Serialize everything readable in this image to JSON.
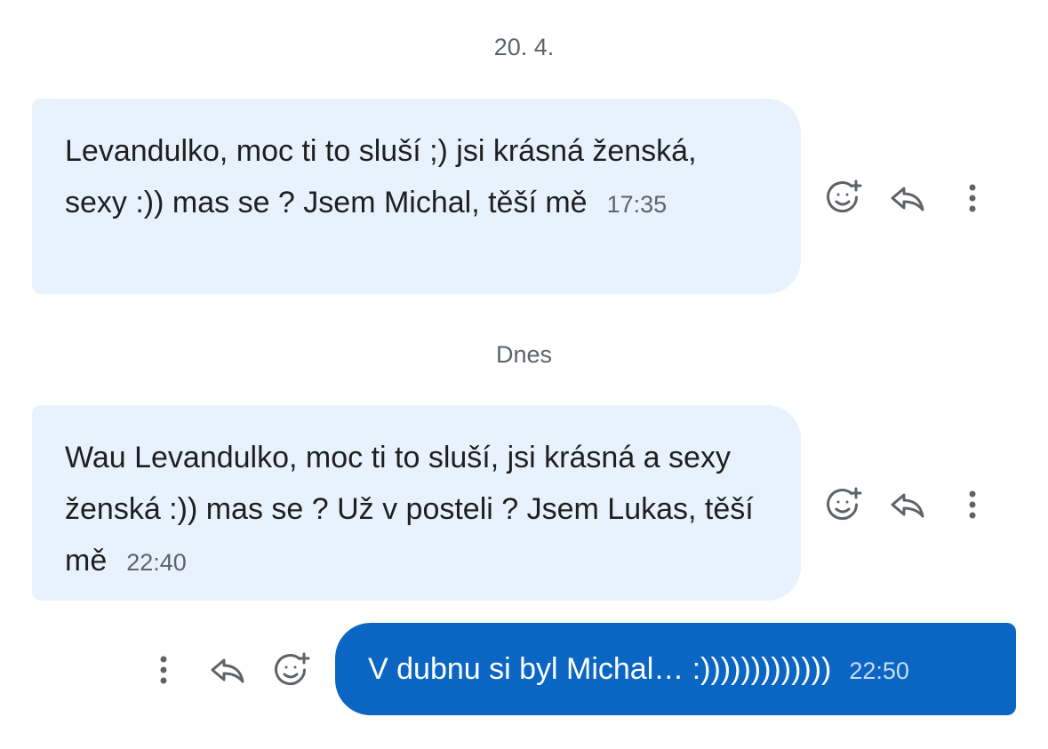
{
  "conversation": {
    "separators": [
      {
        "label": "20. 4."
      },
      {
        "label": "Dnes"
      }
    ],
    "messages": [
      {
        "direction": "incoming",
        "text": "Levandulko, moc ti to sluší ;) jsi krásná ženská, sexy :)) mas se ? Jsem Michal, těší mě",
        "time": "17:35"
      },
      {
        "direction": "incoming",
        "text": "Wau Levandulko, moc ti to sluší, jsi krásná a sexy ženská :)) mas se ? Už v posteli ? Jsem Lukas, těší mě",
        "time": "22:40"
      },
      {
        "direction": "outgoing",
        "text": "V dubnu si byl Michal… :)))))))))))))",
        "time": "22:50"
      }
    ]
  },
  "icons": {
    "react": "add-reaction-icon",
    "reply": "reply-icon",
    "more": "more-options-icon"
  },
  "colors": {
    "incoming_bubble": "#e8f2fd",
    "outgoing_bubble": "#0b66c3",
    "icon_gray": "#5f6368"
  }
}
